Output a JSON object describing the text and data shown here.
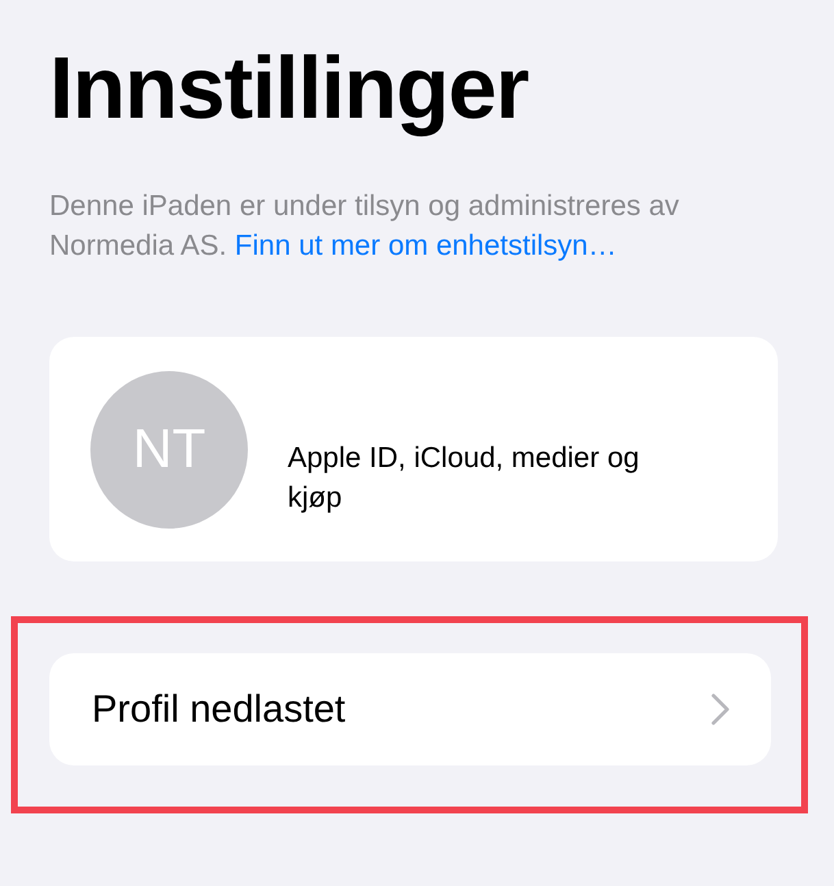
{
  "title": "Innstillinger",
  "notice": {
    "text": "Denne iPaden er under tilsyn og administreres av Normedia AS.",
    "link": "Finn ut mer om enhetstilsyn…"
  },
  "account": {
    "initials": "NT",
    "label": "Apple ID, iCloud, medier og kjøp"
  },
  "profile_row": {
    "label": "Profil nedlastet",
    "highlighted": true
  }
}
